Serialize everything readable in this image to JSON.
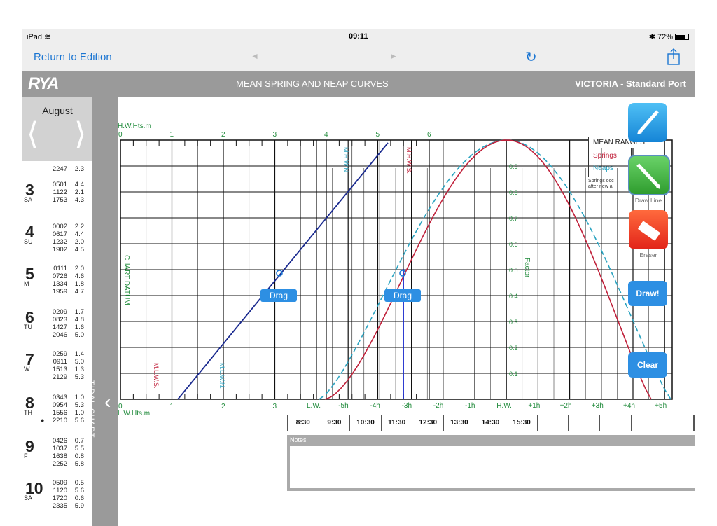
{
  "status_bar": {
    "device": "iPad",
    "time": "09:11",
    "battery": "72%"
  },
  "nav": {
    "back_label": "Return to Edition",
    "prev_arrow": "◄",
    "next_arrow": "►",
    "refresh_icon": "refresh-icon",
    "share_icon": "share-icon"
  },
  "header": {
    "logo": "RYA",
    "title": "MEAN SPRING AND NEAP CURVES",
    "port": "VICTORIA - Standard Port"
  },
  "sidebar": {
    "month": "August",
    "tidal_chart_label": "TIDAL CHART",
    "top_row": {
      "time": "2247",
      "height": "2.3"
    },
    "days": [
      {
        "num": "3",
        "dow": "SA",
        "rows": [
          [
            "0501",
            "4.4"
          ],
          [
            "1122",
            "2.1"
          ],
          [
            "1753",
            "4.3"
          ]
        ]
      },
      {
        "num": "4",
        "dow": "SU",
        "rows": [
          [
            "0002",
            "2.2"
          ],
          [
            "0617",
            "4.4"
          ],
          [
            "1232",
            "2.0"
          ],
          [
            "1902",
            "4.5"
          ]
        ]
      },
      {
        "num": "5",
        "dow": "M",
        "rows": [
          [
            "0111",
            "2.0"
          ],
          [
            "0726",
            "4.6"
          ],
          [
            "1334",
            "1.8"
          ],
          [
            "1959",
            "4.7"
          ]
        ]
      },
      {
        "num": "6",
        "dow": "TU",
        "rows": [
          [
            "0209",
            "1.7"
          ],
          [
            "0823",
            "4.8"
          ],
          [
            "1427",
            "1.6"
          ],
          [
            "2046",
            "5.0"
          ]
        ]
      },
      {
        "num": "7",
        "dow": "W",
        "rows": [
          [
            "0259",
            "1.4"
          ],
          [
            "0911",
            "5.0"
          ],
          [
            "1513",
            "1.3"
          ],
          [
            "2129",
            "5.3"
          ]
        ]
      },
      {
        "num": "8",
        "dow": "TH",
        "rows": [
          [
            "0343",
            "1.0"
          ],
          [
            "0954",
            "5.3"
          ],
          [
            "1556",
            "1.0"
          ],
          [
            "2210",
            "5.6"
          ]
        ]
      },
      {
        "num": "9",
        "dow": "F",
        "rows": [
          [
            "0426",
            "0.7"
          ],
          [
            "1037",
            "5.5"
          ],
          [
            "1638",
            "0.8"
          ],
          [
            "2252",
            "5.8"
          ]
        ]
      },
      {
        "num": "10",
        "dow": "SA",
        "rows": [
          [
            "0509",
            "0.5"
          ],
          [
            "1120",
            "5.6"
          ],
          [
            "1720",
            "0.6"
          ],
          [
            "2335",
            "5.9"
          ]
        ]
      }
    ]
  },
  "chart": {
    "hw_axis_label": "H.W.Hts.m",
    "lw_axis_label": "L.W.Hts.m",
    "hw_ticks": [
      "0",
      "1",
      "2",
      "3",
      "4",
      "5",
      "6"
    ],
    "lw_ticks": [
      "0",
      "1",
      "2",
      "3"
    ],
    "time_ticks": [
      "L.W.",
      "-5h",
      "-4h",
      "-3h",
      "-2h",
      "-1h",
      "H.W.",
      "+1h",
      "+2h",
      "+3h",
      "+4h",
      "+5h"
    ],
    "factor_ticks": [
      "0.9",
      "0.8",
      "0.7",
      "0.6",
      "0.5",
      "0.4",
      "0.3",
      "0.2",
      "0.1"
    ],
    "factor_label": "Factor",
    "chart_datum": "CHART DATUM",
    "mhwn": "M.H.W.N.",
    "mhws": "M.H.W.S.",
    "mlws": "M.L.W.S.",
    "mlwn": "M.L.W.N.",
    "legend": {
      "title": "MEAN RANGES",
      "springs": "Springs",
      "neaps": "Neaps",
      "note1": "Springs occ",
      "note2": "after new a"
    },
    "drag_label": "Drag",
    "spring_color": "#c0203a",
    "neap_color": "#2aa3c0",
    "line_color": "#1a2a8f"
  },
  "tools": {
    "draw_line": "Draw Line",
    "eraser": "Eraser",
    "draw": "Draw!",
    "clear": "Clear"
  },
  "times": [
    "8:30",
    "9:30",
    "10:30",
    "11:30",
    "12:30",
    "13:30",
    "14:30",
    "15:30",
    "",
    "",
    "",
    "",
    ""
  ],
  "notes": {
    "label": "Notes"
  }
}
